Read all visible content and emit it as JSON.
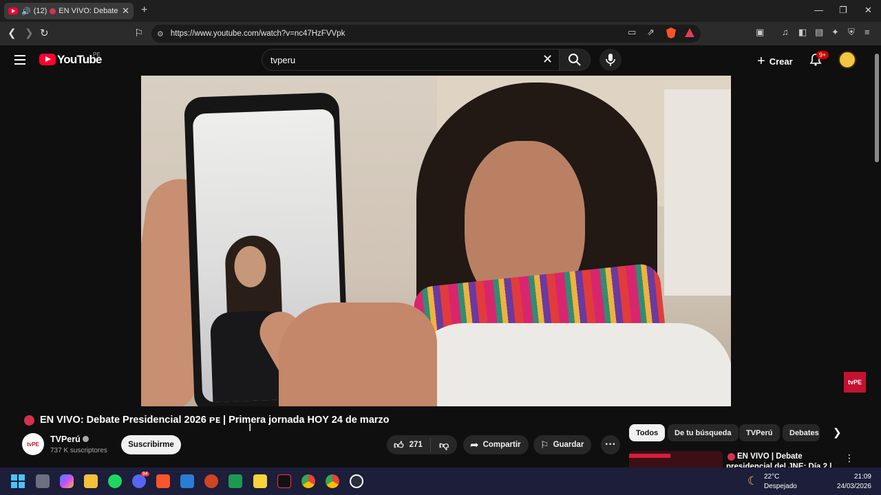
{
  "browser": {
    "tab": {
      "count": "(12)",
      "title": "EN VIVO: Debate Pre"
    },
    "url": "https://www.youtube.com/watch?v=nc47HzFVVpk"
  },
  "youtube": {
    "logo_text": "YouTube",
    "country": "PE",
    "search_value": "tvperu",
    "create_label": "Crear",
    "notif_badge": "9+"
  },
  "video": {
    "title": "EN VIVO: Debate Presidencial 2026 ᴘᴇ | Primera jornada HOY 24 de marzo",
    "overlay_logo": "tvPE",
    "channel": {
      "name": "TVPerú",
      "subscribers": "737 K suscriptores",
      "avatar_text": "tvPE"
    },
    "subscribe_label": "Suscribirme",
    "likes": "271",
    "share_label": "Compartir",
    "save_label": "Guardar"
  },
  "chips": [
    "Todos",
    "De tu búsqueda",
    "TVPerú",
    "Debates"
  ],
  "recommendation": {
    "title": "EN VIVO | Debate presidencial del JNE: Día 2 |"
  },
  "taskbar": {
    "temperature": "22°C",
    "weather": "Despejado",
    "time": "21:09",
    "date": "24/03/2026",
    "discord_badge": "94"
  },
  "colors": {
    "youtube_red": "#ff0033",
    "live_red": "#d7304d",
    "tvperu_red": "#c41230"
  }
}
